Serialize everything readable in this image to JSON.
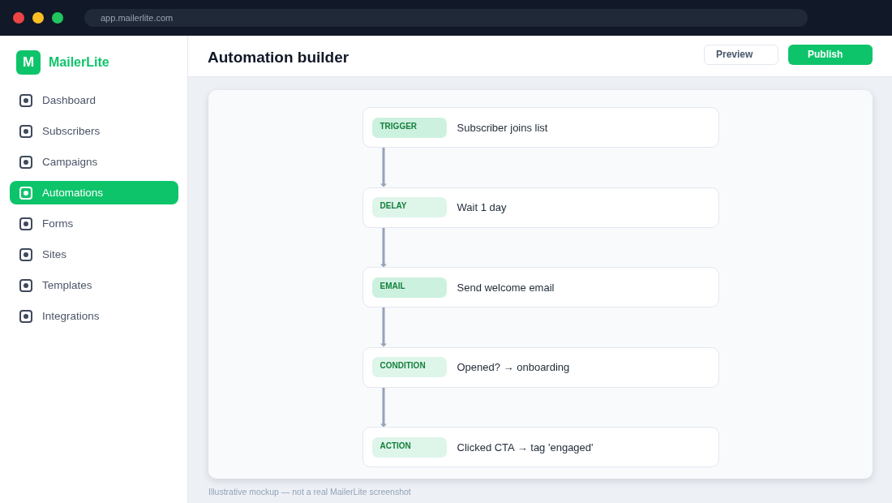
{
  "browser": {
    "url": "app.mailerlite.com"
  },
  "sidebar": {
    "brand": {
      "logo_letter": "M",
      "name": "MailerLite"
    },
    "items": [
      {
        "label": "Dashboard",
        "selected": false
      },
      {
        "label": "Subscribers",
        "selected": false
      },
      {
        "label": "Campaigns",
        "selected": false
      },
      {
        "label": "Automations",
        "selected": true
      },
      {
        "label": "Forms",
        "selected": false
      },
      {
        "label": "Sites",
        "selected": false
      },
      {
        "label": "Templates",
        "selected": false
      },
      {
        "label": "Integrations",
        "selected": false
      }
    ]
  },
  "header": {
    "title": "Automation builder",
    "buttons": [
      {
        "label": "Preview",
        "kind": "secondary"
      },
      {
        "label": "Publish",
        "kind": "primary"
      }
    ]
  },
  "workflow": {
    "steps": [
      {
        "tag": "TRIGGER",
        "color": "#cdf1df",
        "description": "Subscriber joins list"
      },
      {
        "tag": "DELAY",
        "color": "#def5ea",
        "description": "Wait 1 day"
      },
      {
        "tag": "EMAIL",
        "color": "#cdf1df",
        "description": "Send welcome email"
      },
      {
        "tag": "CONDITION",
        "color": "#def5ea",
        "description": "Opened? → onboarding"
      },
      {
        "tag": "ACTION",
        "color": "#def5ea",
        "description": "Clicked CTA → tag 'engaged'"
      }
    ]
  },
  "footnote": "Illustrative mockup — not a real MailerLite screenshot"
}
